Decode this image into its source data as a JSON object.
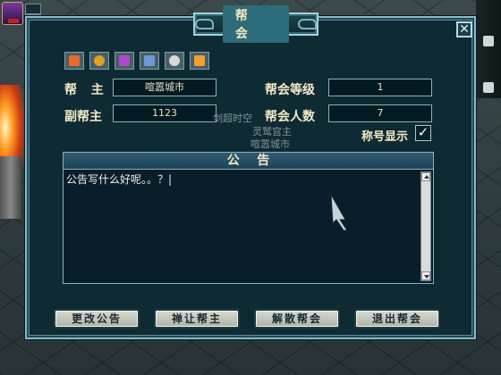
{
  "window": {
    "title": "帮会",
    "close_glyph": "✕"
  },
  "toolbar": {
    "icons": [
      "home-icon",
      "ring-icon",
      "members-icon",
      "hierarchy-icon",
      "search-icon",
      "document-icon"
    ]
  },
  "info": {
    "leader_label": "帮  主",
    "leader_value": "喧嚣城市",
    "vice_leader_label": "副帮主",
    "vice_leader_value": "1123",
    "level_label": "帮会等级",
    "level_value": "1",
    "members_label": "帮会人数",
    "members_value": "7",
    "title_display_label": "称号显示",
    "title_display_checked": "✓"
  },
  "background_text": {
    "line1": "剑超时空",
    "line2": "灵鹫宫主",
    "line3": "喧嚣城市"
  },
  "notice": {
    "header": "公    告",
    "content": "公告写什么好呢。。？|"
  },
  "buttons": {
    "change_notice": "更改公告",
    "transfer_leader": "禅让帮主",
    "disband": "解散帮会",
    "leave": "退出帮会"
  }
}
